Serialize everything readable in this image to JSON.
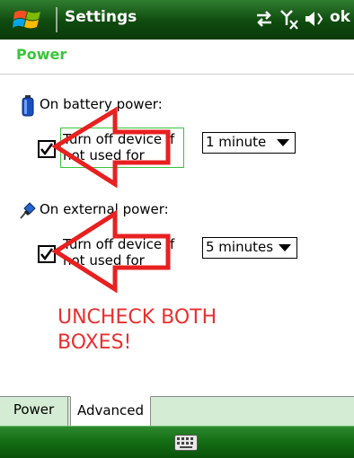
{
  "titlebar": {
    "title": "Settings",
    "ok_label": "ok"
  },
  "page": {
    "title": "Power"
  },
  "battery": {
    "label": "On battery power:",
    "checkbox_text": "Turn off device if not used for",
    "dropdown_value": "1 minute",
    "checked": true
  },
  "external": {
    "label": "On external power:",
    "checkbox_text": "Turn off device if not used for",
    "dropdown_value": "5 minutes",
    "checked": true
  },
  "annotation": {
    "line1": "UNCHECK BOTH",
    "line2": "BOXES!"
  },
  "tabs": [
    {
      "label": "Power"
    },
    {
      "label": "Advanced"
    }
  ],
  "colors": {
    "titlebar": "#0f4a0f",
    "page_title": "#39c639",
    "annotation": "#e83030",
    "focus": "#39c639"
  }
}
